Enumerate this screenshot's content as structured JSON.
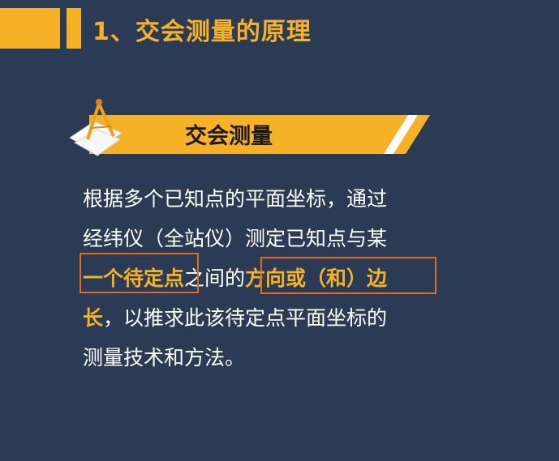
{
  "slide": {
    "title": "1、交会测量的原理"
  },
  "banner": {
    "label": "交会测量",
    "icon": "drafting-compass-icon"
  },
  "body": {
    "line1": "根据多个已知点的平面坐标，通过",
    "line2": "经纬仪（全站仪）测定已知点与某",
    "line3_highlight1": "一个待定点",
    "line3_mid": "之间的",
    "line3_highlight2": "方向或（和）边",
    "line4_highlight": "长",
    "line4_rest": "，以推求此该待定点平面坐标的",
    "line5": "测量技术和方法。"
  },
  "colors": {
    "background": "#2b3a55",
    "accent": "#f5b227",
    "highlight_box": "#e06a1f",
    "text": "#ffffff"
  }
}
